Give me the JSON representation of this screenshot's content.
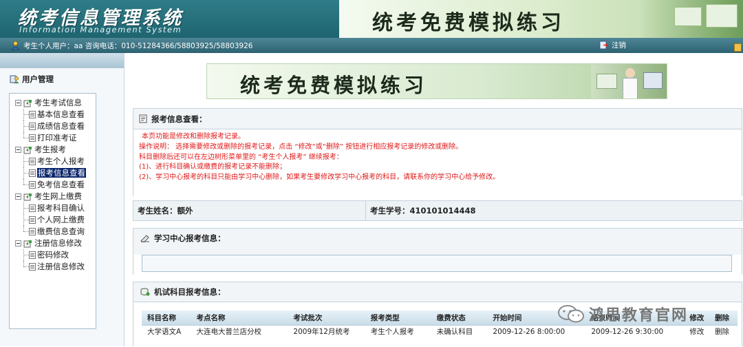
{
  "header": {
    "title": "统考信息管理系统",
    "subtitle": "Information Management System",
    "banner_text": "统考免费模拟练习"
  },
  "userbar": {
    "user_text": "考生个人用户：aa 咨询电话：010-51284366/58803925/58803926",
    "logout_label": "注销"
  },
  "sidebar": {
    "heading": "用户管理",
    "groups": [
      {
        "label": "考生考试信息",
        "items": [
          "基本信息查看",
          "成绩信息查看",
          "打印准考证"
        ]
      },
      {
        "label": "考生报考",
        "items": [
          "考生个人报考",
          "报考信息查看",
          "免考信息查看"
        ],
        "selected": "报考信息查看"
      },
      {
        "label": "考生网上缴费",
        "items": [
          "报考科目确认",
          "个人网上缴费",
          "缴费信息查询"
        ]
      },
      {
        "label": "注册信息修改",
        "items": [
          "密码修改",
          "注册信息修改"
        ]
      }
    ]
  },
  "main": {
    "banner_text": "统考免费模拟练习",
    "report_panel": {
      "title": "报考信息查看：",
      "notice": [
        "本页功能是修改和删除报考记录。",
        "操作说明： 选择需要修改或删除的报考记录，点击 “修改”或“删除” 按钮进行相应报考记录的修改或删除。",
        "科目删除后还可以在左边树形菜单里的 “考生个人报考” 继续报考：",
        "(1)、进行科目确认或缴费的报考记录不能删除；",
        "(2)、学习中心报考的科目只能由学习中心删除，如果考生要修改学习中心报考的科目，请联系你的学习中心给予修改。"
      ]
    },
    "student": {
      "name_label": "考生姓名：",
      "name_value": "额外",
      "id_label": "考生学号：",
      "id_value": "410101014448"
    },
    "study_panel": {
      "title": "学习中心报考信息："
    },
    "exam_panel": {
      "title": "机试科目报考信息：",
      "columns": [
        "科目名称",
        "考点名称",
        "考试批次",
        "报考类型",
        "缴费状态",
        "开始时间",
        "结束时间",
        "修改",
        "删除"
      ],
      "rows": [
        [
          "大学语文A",
          "大连电大普兰店分校",
          "2009年12月统考",
          "考生个人报考",
          "未确认科目",
          "2009-12-26  8:00:00",
          "2009-12-26  9:30:00",
          "修改",
          "删除"
        ]
      ]
    },
    "watermark": "鸿思教育官网"
  },
  "colors": {
    "header_bg": "#2f7d88",
    "notice_text": "#e01818",
    "selected_bg": "#0a246a"
  }
}
